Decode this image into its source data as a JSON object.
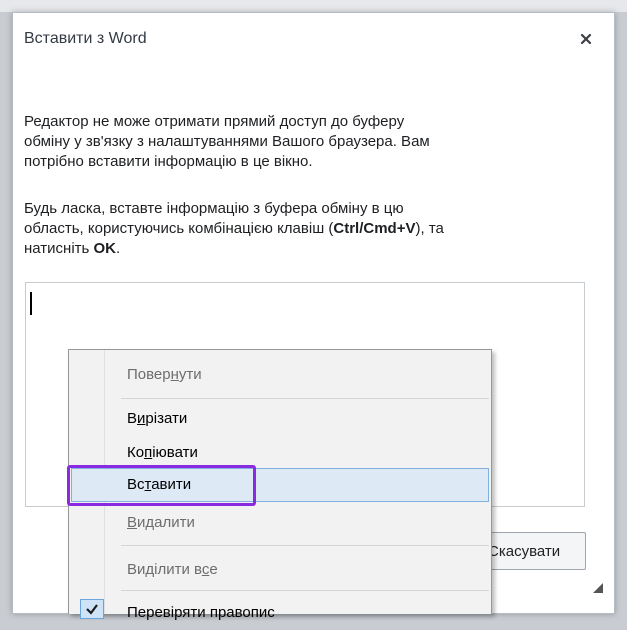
{
  "dialog": {
    "title": "Вставити з Word",
    "message1_line1": "Редактор не може отримати прямий доступ до буферу",
    "message1_line2": "обміну у зв'язку з налаштуваннями Вашого браузера. Вам",
    "message1_line3": "потрібно вставити інформацію в це вікно.",
    "message2_line1": "Будь ласка, вставте інформацію з буфера обміну в цю",
    "message2_line2a": "область, користуючись комбінацією клавіш (",
    "message2_shortcut": "Ctrl/Cmd+V",
    "message2_line2b": "), та",
    "message2_line3a": "натисніть ",
    "message2_ok": "OK",
    "message2_line3b": ".",
    "cancel_label": "Скасувати"
  },
  "context_menu": {
    "undo": {
      "pre": "Повер",
      "u": "н",
      "post": "ути"
    },
    "cut": {
      "pre": "В",
      "u": "и",
      "post": "різати"
    },
    "copy": {
      "pre": "Ко",
      "u": "п",
      "post": "іювати"
    },
    "paste": {
      "pre": "Вс",
      "u": "т",
      "post": "авити"
    },
    "delete": {
      "pre": "",
      "u": "В",
      "post": "идалити"
    },
    "select_all": {
      "pre": "Виділити в",
      "u": "с",
      "post": "е"
    },
    "spellcheck": {
      "pre": "Перевіряти правопис",
      "u": "",
      "post": ""
    }
  },
  "colors": {
    "highlight": "#8a2be2",
    "hover_bg": "#ddeaf6"
  }
}
